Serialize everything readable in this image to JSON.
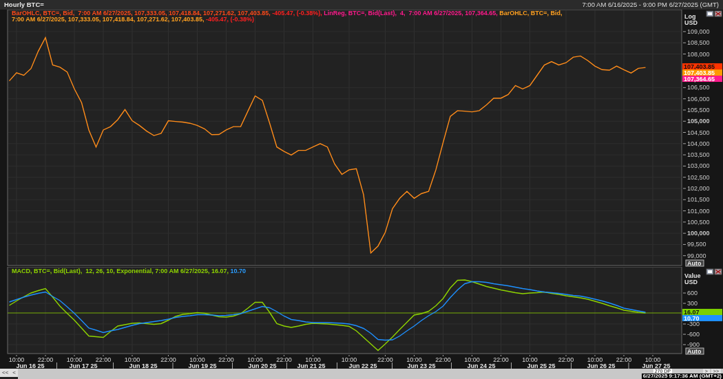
{
  "header": {
    "title": "Hourly BTC=",
    "range": "7:00 AM 6/16/2025 - 9:00 PM 6/27/2025 (GMT)"
  },
  "price_panel": {
    "legend": [
      [
        {
          "text": "BarOHLC, BTC=, Bid,  7:00 AM 6/27/2025, 107,333.05, 107,418.84, 107,271.62, 107,403.85, ",
          "color": "#ff4a1a"
        },
        {
          "text": "-405.47, (-0.38%), ",
          "color": "#ff2020"
        },
        {
          "text": "LinReg, BTC=, Bid(Last),  4,  7:00 AM 6/27/2025, 107,364.65, ",
          "color": "#ff1a8c"
        },
        {
          "text": "BarOHLC, BTC=, Bid,",
          "color": "#ffa020"
        }
      ],
      [
        {
          "text": "7:00 AM 6/27/2025, 107,333.05, 107,418.84, 107,271.62, 107,403.85, ",
          "color": "#ffa020"
        },
        {
          "text": "-405.47, (-0.38%)",
          "color": "#ff2020"
        }
      ]
    ],
    "axis_labels": [
      "Log",
      "USD"
    ],
    "tags": [
      {
        "text": "107,403.85",
        "color": "#ff3300"
      },
      {
        "text": "107,403.85",
        "color": "#ff9900"
      },
      {
        "text": "107,364.65",
        "color": "#ff1a8c"
      }
    ],
    "auto_button": "Auto",
    "chart_data": {
      "type": "line",
      "grid": true,
      "ylim": [
        98500,
        109980
      ],
      "yticks": [
        {
          "value": 99000,
          "label": "99,000"
        },
        {
          "value": 99500,
          "label": "99,500"
        },
        {
          "value": 100000,
          "label": "100,000"
        },
        {
          "value": 100500,
          "label": "100,500"
        },
        {
          "value": 101000,
          "label": "101,000"
        },
        {
          "value": 101500,
          "label": "101,500"
        },
        {
          "value": 102000,
          "label": "102,000"
        },
        {
          "value": 102500,
          "label": "102,500"
        },
        {
          "value": 103000,
          "label": "103,000"
        },
        {
          "value": 103500,
          "label": "103,500"
        },
        {
          "value": 104000,
          "label": "104,000"
        },
        {
          "value": 104500,
          "label": "104,500"
        },
        {
          "value": 105000,
          "label": "105,000"
        },
        {
          "value": 105500,
          "label": "105,500"
        },
        {
          "value": 106000,
          "label": "106,000"
        },
        {
          "value": 106500,
          "label": "106,500"
        },
        {
          "value": 108000,
          "label": "108,000"
        },
        {
          "value": 108500,
          "label": "108,500"
        },
        {
          "value": 109000,
          "label": "109,000"
        }
      ],
      "categories": [
        null,
        null,
        null,
        null,
        null,
        null,
        null,
        null,
        null,
        null,
        null,
        null,
        null,
        null,
        null,
        null,
        null,
        null,
        null,
        null,
        null,
        null,
        null,
        null,
        null,
        null,
        null,
        null,
        null,
        null,
        null,
        null,
        null,
        null,
        null,
        null,
        null,
        null,
        null,
        null,
        null,
        null,
        null,
        null,
        null,
        null,
        null,
        null,
        null,
        null,
        null,
        null,
        null,
        null,
        null,
        null,
        null,
        null,
        null,
        null,
        null,
        null,
        null,
        null,
        null,
        null,
        null,
        null,
        null,
        null,
        null,
        null,
        null,
        null,
        null,
        null,
        null,
        null,
        null,
        null,
        null,
        null,
        null,
        null,
        null,
        null,
        null,
        null,
        null,
        null
      ],
      "series": [
        {
          "color": "#ff8c1a",
          "values": [
            106800,
            107160,
            107050,
            107350,
            108120,
            108730,
            107510,
            107410,
            107200,
            106440,
            105830,
            104610,
            103850,
            104610,
            104760,
            105070,
            105520,
            105020,
            104810,
            104560,
            104360,
            104460,
            105020,
            104990,
            104960,
            104910,
            104810,
            104660,
            104400,
            104410,
            104610,
            104760,
            104760,
            105450,
            106130,
            105930,
            104920,
            103850,
            103650,
            103490,
            103700,
            103700,
            103850,
            104000,
            103850,
            103090,
            102630,
            102830,
            102880,
            101720,
            99120,
            99430,
            100040,
            101100,
            101560,
            101870,
            101560,
            101770,
            101870,
            102830,
            104050,
            105220,
            105470,
            105450,
            105420,
            105470,
            105730,
            106030,
            106030,
            106190,
            106590,
            106440,
            106590,
            107050,
            107510,
            107660,
            107510,
            107610,
            107860,
            107910,
            107710,
            107460,
            107300,
            107280,
            107460,
            107300,
            107150,
            107360,
            107400,
            null
          ]
        }
      ]
    }
  },
  "macd_panel": {
    "legend": [
      [
        {
          "text": "MACD, BTC=, Bid(Last),  12, 26, 10, Exponential, 7:00 AM 6/27/2025, 16.07, ",
          "color": "#8fd400"
        },
        {
          "text": "10.70",
          "color": "#2a9dff"
        }
      ]
    ],
    "axis_labels": [
      "Value",
      "USD"
    ],
    "tags": [
      {
        "text": "16.07",
        "color": "#7ccf00"
      },
      {
        "text": "10.70",
        "color": "#1e90ff"
      }
    ],
    "auto_button": "Auto",
    "chart_data": {
      "type": "line",
      "grid": true,
      "ylim": [
        -1200,
        1360
      ],
      "ref_lines": [
        {
          "axis": "y",
          "value": 20,
          "color": "#8fd400"
        }
      ],
      "yticks": [
        {
          "value": -900,
          "label": "-900"
        },
        {
          "value": -600,
          "label": "-600"
        },
        {
          "value": -300,
          "label": "-300"
        },
        {
          "value": 300,
          "label": "300"
        },
        {
          "value": 600,
          "label": "600"
        }
      ],
      "categories": [
        null,
        "10:00",
        null,
        null,
        null,
        "22:00",
        null,
        null,
        null,
        "10:00",
        null,
        null,
        null,
        "22:00",
        null,
        null,
        null,
        "10:00",
        null,
        null,
        null,
        null,
        "22:00",
        null,
        null,
        null,
        "10:00",
        null,
        null,
        null,
        "22:00",
        null,
        null,
        null,
        "10:00",
        null,
        null,
        null,
        "22:00",
        null,
        null,
        null,
        "10:00",
        null,
        null,
        null,
        null,
        "10:00",
        null,
        null,
        null,
        null,
        "22:00",
        null,
        null,
        null,
        "10:00",
        null,
        null,
        null,
        "22:00",
        null,
        null,
        null,
        "10:00",
        null,
        null,
        null,
        "22:00",
        null,
        null,
        null,
        "10:00",
        null,
        null,
        null,
        null,
        "22:00",
        null,
        null,
        null,
        "10:00",
        null,
        null,
        null,
        "22:00",
        null,
        null,
        null,
        "10:00"
      ],
      "series": [
        {
          "color": "#8fd400",
          "values": [
            240,
            370,
            490,
            600,
            670,
            730,
            480,
            220,
            10,
            -190,
            -420,
            -650,
            -670,
            -690,
            -520,
            -360,
            -320,
            -280,
            -270,
            -290,
            -310,
            -290,
            -190,
            -80,
            -20,
            0,
            30,
            10,
            -40,
            -90,
            -100,
            -70,
            0,
            160,
            330,
            330,
            40,
            -290,
            -360,
            -400,
            -360,
            -310,
            -280,
            -290,
            -300,
            -320,
            -340,
            -370,
            -500,
            -690,
            -880,
            -1070,
            -880,
            -680,
            -460,
            -250,
            -40,
            0,
            70,
            230,
            440,
            750,
            970,
            980,
            930,
            860,
            790,
            740,
            690,
            650,
            610,
            580,
            600,
            610,
            630,
            590,
            560,
            520,
            490,
            460,
            420,
            360,
            300,
            230,
            170,
            100,
            70,
            40,
            20,
            null
          ]
        },
        {
          "color": "#1e90ff",
          "values": [
            340,
            410,
            480,
            540,
            590,
            630,
            500,
            380,
            200,
            10,
            -200,
            -420,
            -480,
            -550,
            -500,
            -460,
            -400,
            -340,
            -290,
            -260,
            -230,
            -200,
            -160,
            -110,
            -80,
            -60,
            -30,
            -30,
            -40,
            -60,
            -50,
            -30,
            0,
            70,
            140,
            210,
            170,
            60,
            -70,
            -170,
            -200,
            -240,
            -260,
            -260,
            -260,
            -270,
            -280,
            -300,
            -350,
            -430,
            -570,
            -750,
            -770,
            -760,
            -650,
            -500,
            -360,
            -200,
            -60,
            60,
            220,
            470,
            690,
            870,
            930,
            930,
            910,
            870,
            840,
            810,
            770,
            730,
            700,
            660,
            630,
            610,
            590,
            560,
            530,
            510,
            470,
            420,
            370,
            310,
            240,
            160,
            120,
            80,
            40,
            null
          ]
        }
      ]
    }
  },
  "time_axis": {
    "date_labels": [
      "Jun 16 25",
      "Jun 17 25",
      "Jun 18 25",
      "Jun 19 25",
      "Jun 20 25",
      "Jun 21 25",
      "Jun 22 25",
      "Jun 23 25",
      "Jun 24 25",
      "Jun 25 25",
      "Jun 26 25",
      "Jun 27 25"
    ]
  },
  "scrollbar": {
    "left_buttons": [
      "<<",
      "<"
    ],
    "right_buttons": [
      ">",
      ">>"
    ],
    "points": "270 DP"
  },
  "status": "6/27/2025 9:17:36 AM (GMT+2)"
}
